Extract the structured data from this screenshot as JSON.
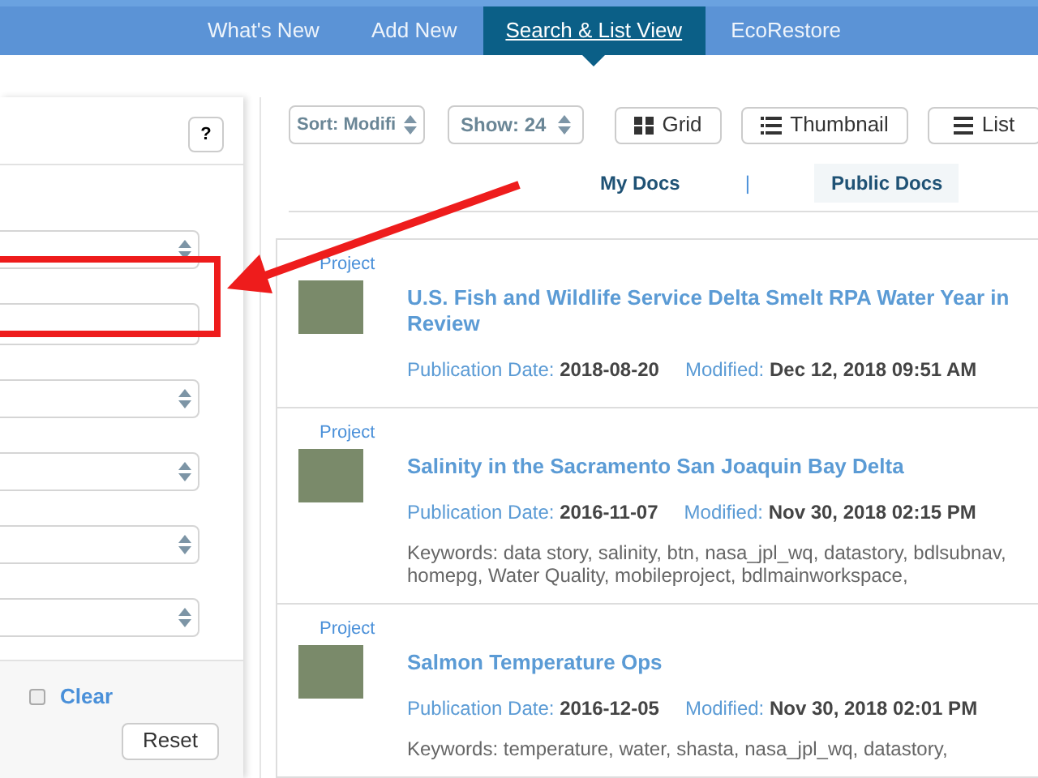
{
  "nav": {
    "tabs": [
      {
        "label": "What's New",
        "selected": false
      },
      {
        "label": "Add New",
        "selected": false
      },
      {
        "label": "Search & List View",
        "selected": true
      },
      {
        "label": "EcoRestore",
        "selected": false
      }
    ]
  },
  "filter_panel": {
    "help_button": "?",
    "fields": [
      {
        "kind": "select"
      },
      {
        "kind": "text"
      },
      {
        "kind": "select"
      },
      {
        "kind": "select"
      },
      {
        "kind": "select"
      },
      {
        "kind": "select"
      }
    ],
    "clear": {
      "label": "Clear",
      "checked": false
    },
    "reset_button": "Reset"
  },
  "toolbar": {
    "sort": "Sort: Modifi",
    "show": "Show: 24",
    "views": [
      {
        "kind": "grid",
        "label": "Grid"
      },
      {
        "kind": "thumbnail",
        "label": "Thumbnail"
      },
      {
        "kind": "list",
        "label": "List"
      }
    ]
  },
  "doc_tabs": {
    "items": [
      {
        "label": "My Docs",
        "selected": false
      },
      {
        "label": "Public Docs",
        "selected": true
      }
    ],
    "separator": "|"
  },
  "results": [
    {
      "type": "Project",
      "title": "U.S. Fish and Wildlife Service Delta Smelt RPA Water Year in Review",
      "pub_label": "Publication Date:",
      "pub_date": "2018-08-20",
      "mod_label": "Modified:",
      "modified": "Dec 12, 2018 09:51 AM"
    },
    {
      "type": "Project",
      "title": "Salinity in the Sacramento San Joaquin Bay Delta",
      "pub_label": "Publication Date:",
      "pub_date": "2016-11-07",
      "mod_label": "Modified:",
      "modified": "Nov 30, 2018 02:15 PM",
      "keywords": "Keywords: data story, salinity, btn, nasa_jpl_wq, datastory, bdlsubnav, homepg, Water Quality, mobileproject, bdlmainworkspace,"
    },
    {
      "type": "Project",
      "title": "Salmon Temperature Ops",
      "pub_label": "Publication Date:",
      "pub_date": "2016-12-05",
      "mod_label": "Modified:",
      "modified": "Nov 30, 2018 02:01 PM",
      "keywords": "Keywords: temperature, water, shasta, nasa_jpl_wq, datastory,"
    }
  ]
}
